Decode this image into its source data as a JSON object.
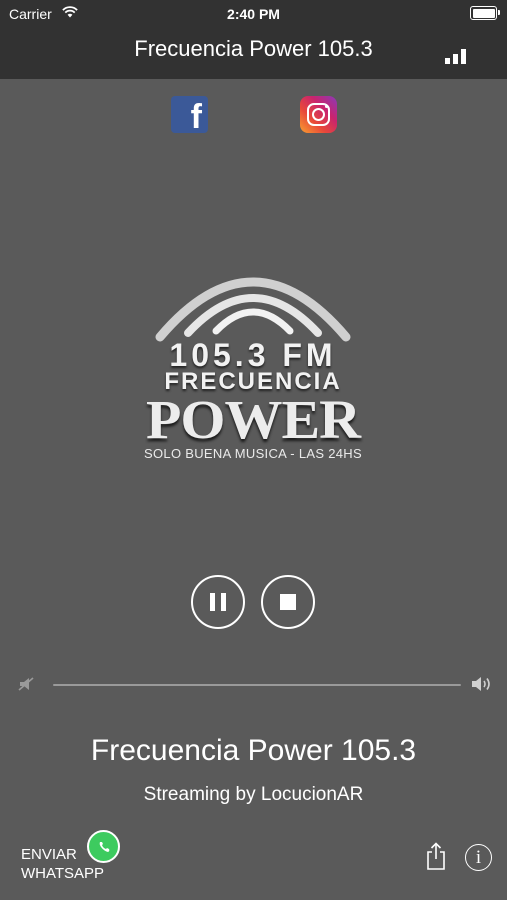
{
  "status_bar": {
    "carrier": "Carrier",
    "time": "2:40 PM"
  },
  "nav": {
    "title": "Frecuencia Power 105.3"
  },
  "social": {
    "facebook_glyph": "f",
    "icons": [
      "facebook-icon",
      "instagram-icon"
    ]
  },
  "logo": {
    "frequency": "105.3 FM",
    "name_line": "FRECUENCIA",
    "brand": "POWER",
    "tagline": "SOLO BUENA MUSICA - LAS 24HS"
  },
  "player": {
    "state": "playing",
    "controls": [
      "pause-icon",
      "stop-icon"
    ],
    "volume": 1.0
  },
  "info": {
    "station": "Frecuencia Power 105.3",
    "streaming": "Streaming by LocucionAR"
  },
  "footer": {
    "whatsapp_line1": "ENVIAR",
    "whatsapp_line2": "WHATSAPP",
    "info_glyph": "i"
  },
  "colors": {
    "background": "#5a5a5a",
    "top_bar": "#323232",
    "facebook": "#3b5998",
    "whatsapp": "#3dcb5f"
  }
}
